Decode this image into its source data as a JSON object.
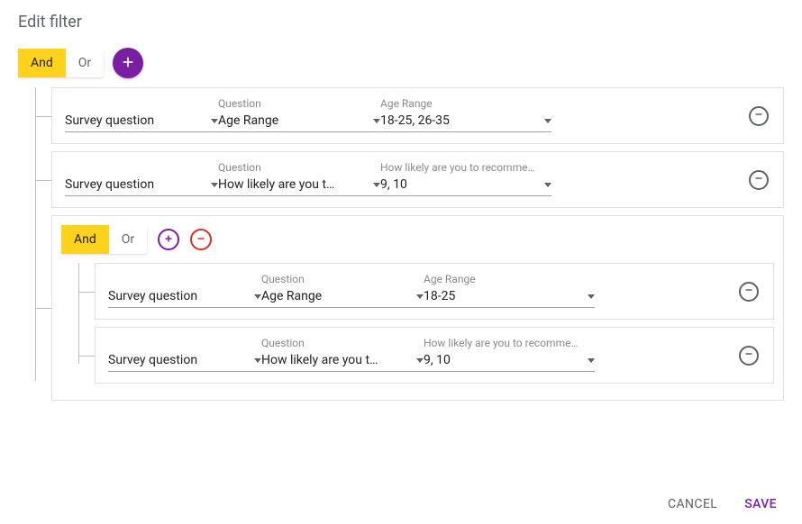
{
  "title": "Edit filter",
  "colors": {
    "accent": "#7b1fa2",
    "active": "#ffd21e",
    "danger": "#d93025",
    "neutral": "#5f6368"
  },
  "root": {
    "operator": {
      "options": [
        "And",
        "Or"
      ],
      "active": "And"
    },
    "addIcon": "plus-icon",
    "rows": [
      {
        "type": "condition",
        "sourceLabel": "Survey question",
        "questionHeader": "Question",
        "question": "Age Range",
        "answerHeader": "Age Range",
        "value": "18-25, 26-35"
      },
      {
        "type": "condition",
        "sourceLabel": "Survey question",
        "questionHeader": "Question",
        "question": "How likely are you t…",
        "answerHeader": "How likely are you to recomme…",
        "value": "9, 10"
      },
      {
        "type": "group",
        "operator": {
          "options": [
            "And",
            "Or"
          ],
          "active": "And"
        },
        "icons": [
          "plus-icon",
          "minus-icon"
        ],
        "rows": [
          {
            "sourceLabel": "Survey question",
            "questionHeader": "Question",
            "question": "Age Range",
            "answerHeader": "Age Range",
            "value": "18-25"
          },
          {
            "sourceLabel": "Survey question",
            "questionHeader": "Question",
            "question": "How likely are you t…",
            "answerHeader": "How likely are you to recomme…",
            "value": "9, 10"
          }
        ]
      }
    ]
  },
  "footer": {
    "cancel": "CANCEL",
    "save": "SAVE"
  }
}
